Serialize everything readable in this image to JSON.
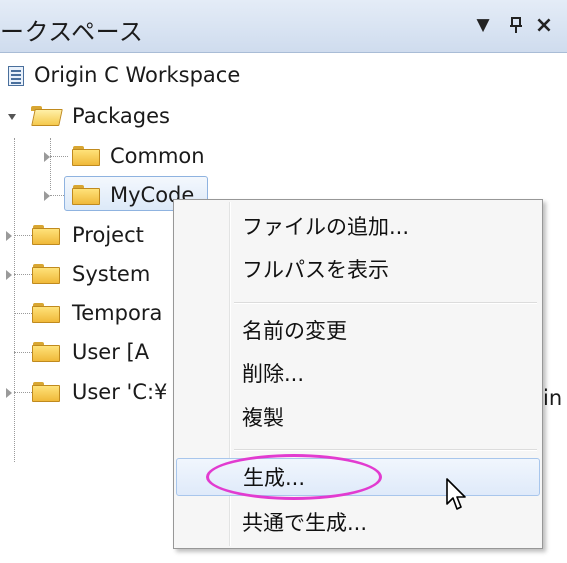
{
  "panel": {
    "title": "ークスペース",
    "dropdown_glyph": "▼",
    "pin_glyph": "ᴨ",
    "close_glyph": "×"
  },
  "tree": {
    "root_label": "Origin C Workspace",
    "packages_label": "Packages",
    "common_label": "Common",
    "mycode_label": "MyCode",
    "project_label": "Project",
    "system_label": "System",
    "temporary_label": "Tempora",
    "user_a_label": "User [A",
    "user_c_label": "User 'C:¥",
    "user_c_trailing": "in"
  },
  "context_menu": {
    "items": [
      {
        "label": "ファイルの追加..."
      },
      {
        "label": "フルパスを表示"
      },
      {
        "label": "名前の変更"
      },
      {
        "label": "削除..."
      },
      {
        "label": "複製"
      },
      {
        "label": "生成...",
        "highlighted": true
      },
      {
        "label": "共通で生成..."
      }
    ]
  },
  "colors": {
    "highlight_ellipse": "#e23bd0",
    "titlebar_top": "#e4ecf7",
    "titlebar_bottom": "#cfdcee",
    "menu_hover_border": "#a8c6ec"
  }
}
